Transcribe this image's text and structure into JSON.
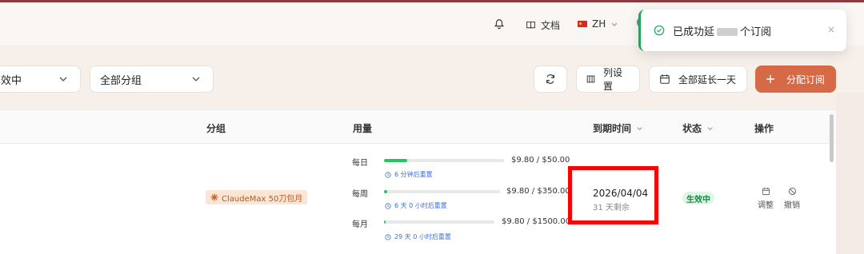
{
  "header": {
    "docs_label": "文档",
    "lang_label": "ZH"
  },
  "toast": {
    "prefix": "已成功延",
    "suffix": "个订阅",
    "close": "×"
  },
  "filters": {
    "status_value": "效中",
    "group_value": "全部分组"
  },
  "toolbar": {
    "columns_label": "列设置",
    "extend_label": "全部延长一天",
    "assign_label": "分配订阅"
  },
  "table": {
    "headers": {
      "group": "分组",
      "usage": "用量",
      "expiry": "到期时间",
      "status": "状态",
      "actions": "操作"
    },
    "row": {
      "group_badge": "ClaudeMax 50刀包月",
      "usage": [
        {
          "label": "每日",
          "amount": "$9.80 / $50.00",
          "reset": "6 分钟后重置",
          "fraction": 0.196
        },
        {
          "label": "每周",
          "amount": "$9.80 / $350.00",
          "reset": "6 天 0 小时后重置",
          "fraction": 0.028
        },
        {
          "label": "每月",
          "amount": "$9.80 / $1500.00",
          "reset": "29 天 0 小时后重置",
          "fraction": 0.0065
        }
      ],
      "expiry_date": "2026/04/04",
      "expiry_remaining": "31 天剩余",
      "status": "生效中",
      "action_adjust": "调整",
      "action_revoke": "撤销"
    }
  },
  "colors": {
    "accent": "#d66a46",
    "success": "#22c55e",
    "highlight": "#ff0000"
  }
}
